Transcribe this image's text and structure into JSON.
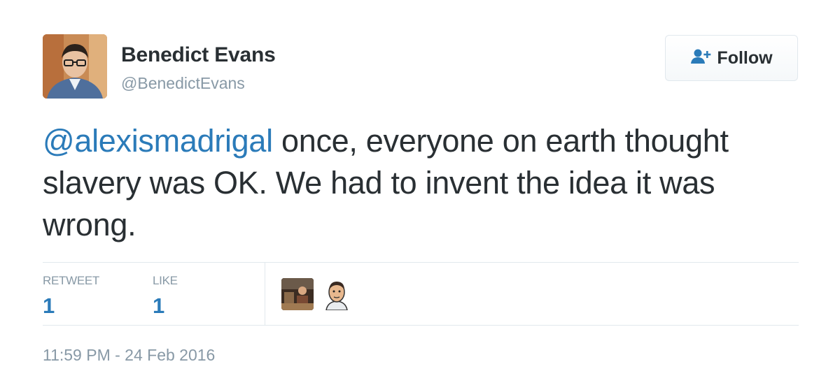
{
  "author": {
    "display_name": "Benedict Evans",
    "handle": "@BenedictEvans"
  },
  "follow_button": {
    "label": "Follow",
    "icon": "follow-user-icon"
  },
  "tweet": {
    "mention": "@alexismadrigal",
    "text": " once, everyone on earth thought slavery was OK. We had to invent the idea it was wrong."
  },
  "stats": {
    "retweet_label": "RETWEET",
    "retweet_count": "1",
    "like_label": "LIKE",
    "like_count": "1"
  },
  "timestamp": "11:59 PM - 24 Feb 2016",
  "colors": {
    "link": "#2b7bb9",
    "secondary_text": "#8899a6",
    "primary_text": "#292f33",
    "divider": "#e1e8ed"
  }
}
